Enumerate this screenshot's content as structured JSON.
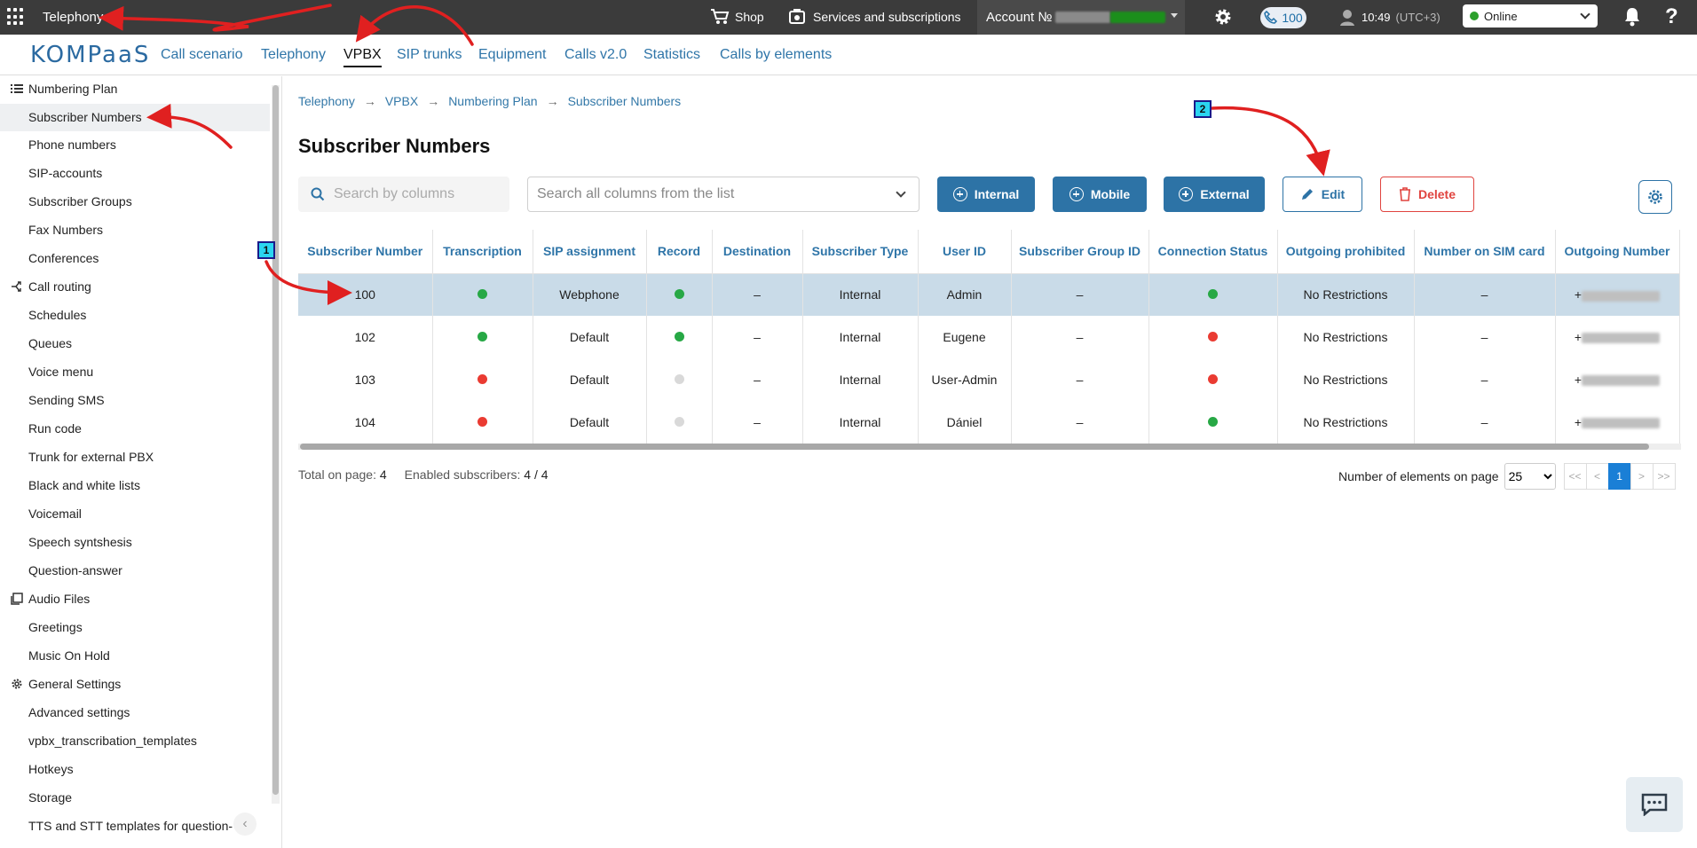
{
  "topbar": {
    "app_title": "Telephony",
    "shop": "Shop",
    "services": "Services and subscriptions",
    "account_label": "Account №",
    "calls_count": "100",
    "time": "10:49",
    "timezone": "(UTC+3)",
    "status": "Online"
  },
  "nav": {
    "logo": "KOMPaaS",
    "items": [
      "Call scenario",
      "Telephony",
      "VPBX",
      "SIP trunks",
      "Equipment",
      "Calls v2.0",
      "Statistics",
      "Calls by elements"
    ],
    "active": "VPBX"
  },
  "sidebar": {
    "sections": [
      {
        "label": "Numbering Plan",
        "icon": "list-icon"
      },
      {
        "label": "Call routing",
        "icon": "routing-icon"
      },
      {
        "label": "Audio Files",
        "icon": "audio-files-icon"
      },
      {
        "label": "General Settings",
        "icon": "gear-icon"
      }
    ],
    "items": [
      "Subscriber Numbers",
      "Phone numbers",
      "SIP-accounts",
      "Subscriber Groups",
      "Fax Numbers",
      "Conferences",
      "Schedules",
      "Queues",
      "Voice menu",
      "Sending SMS",
      "Run code",
      "Trunk for external PBX",
      "Black and white lists",
      "Voicemail",
      "Speech syntshesis",
      "Question-answer",
      "Greetings",
      "Music On Hold",
      "Advanced settings",
      "vpbx_transcribation_templates",
      "Hotkeys",
      "Storage",
      "TTS and STT templates for question-"
    ],
    "active_item": "Subscriber Numbers"
  },
  "breadcrumb": [
    "Telephony",
    "VPBX",
    "Numbering Plan",
    "Subscriber Numbers"
  ],
  "page_title": "Subscriber Numbers",
  "toolbar": {
    "search_placeholder": "Search by columns",
    "columns_placeholder": "Search all columns from the list",
    "internal": "Internal",
    "mobile": "Mobile",
    "external": "External",
    "edit": "Edit",
    "delete": "Delete"
  },
  "table": {
    "columns": [
      "Subscriber Number",
      "Transcription",
      "SIP assignment",
      "Record",
      "Destination",
      "Subscriber Type",
      "User ID",
      "Subscriber Group ID",
      "Connection Status",
      "Outgoing prohibited",
      "Number on SIM card",
      "Outgoing Number"
    ],
    "rows": [
      {
        "number": "100",
        "transcription": "green",
        "sip": "Webphone",
        "record": "green",
        "destination": "–",
        "type": "Internal",
        "user": "Admin",
        "group": "–",
        "connection": "green",
        "outgoing_prohibited": "No Restrictions",
        "sim": "–",
        "outgoing_prefix": "+",
        "selected": true
      },
      {
        "number": "102",
        "transcription": "green",
        "sip": "Default",
        "record": "green",
        "destination": "–",
        "type": "Internal",
        "user": "Eugene",
        "group": "–",
        "connection": "red",
        "outgoing_prohibited": "No Restrictions",
        "sim": "–",
        "outgoing_prefix": "+",
        "selected": false
      },
      {
        "number": "103",
        "transcription": "red",
        "sip": "Default",
        "record": "gray",
        "destination": "–",
        "type": "Internal",
        "user": "User-Admin",
        "group": "–",
        "connection": "red",
        "outgoing_prohibited": "No Restrictions",
        "sim": "–",
        "outgoing_prefix": "+",
        "selected": false
      },
      {
        "number": "104",
        "transcription": "red",
        "sip": "Default",
        "record": "gray",
        "destination": "–",
        "type": "Internal",
        "user": "Dániel",
        "group": "–",
        "connection": "green",
        "outgoing_prohibited": "No Restrictions",
        "sim": "–",
        "outgoing_prefix": "+",
        "selected": false
      }
    ]
  },
  "footer": {
    "total_label": "Total on page:",
    "total_value": "4",
    "enabled_label": "Enabled subscribers:",
    "enabled_value": "4 / 4",
    "per_page_label": "Number of elements on page",
    "per_page": "25",
    "pager": [
      "<<",
      "<",
      "1",
      ">",
      ">>"
    ],
    "current_page": "1"
  },
  "annotations": {
    "step1": "1",
    "step2": "2"
  },
  "colors": {
    "accent": "#2d73a6",
    "danger": "#e0443f",
    "selected_row": "#c9dbe8",
    "status_green": "#27a845",
    "status_red": "#ea3b32"
  }
}
